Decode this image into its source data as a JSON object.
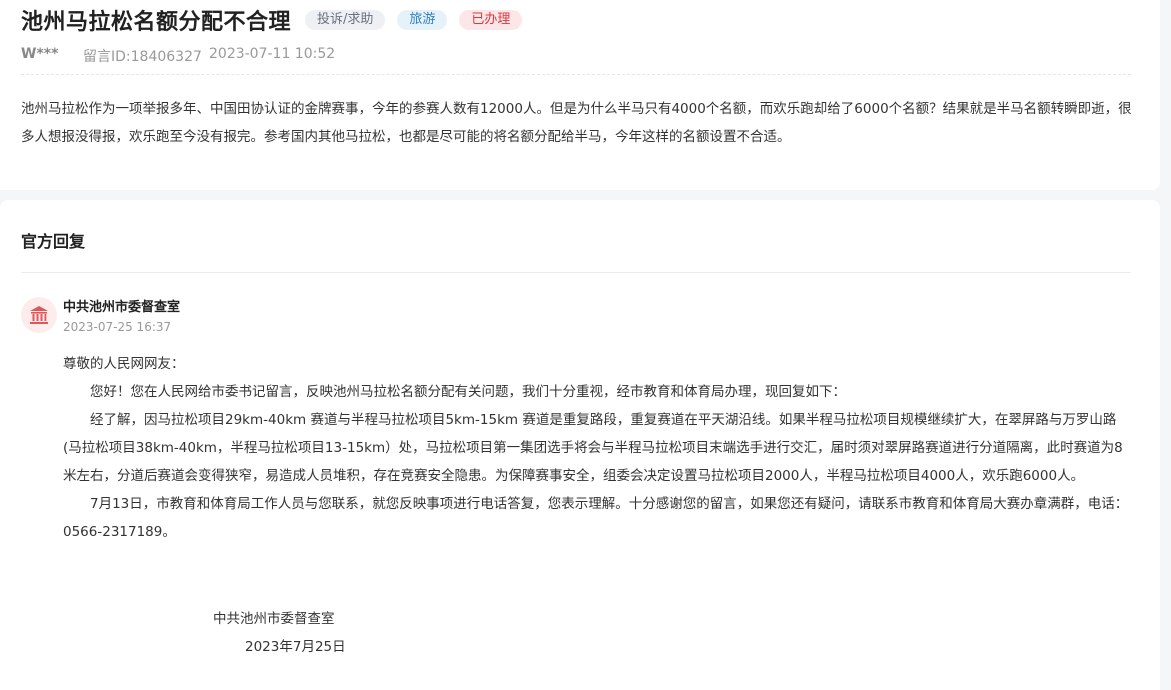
{
  "post": {
    "title": "池州马拉松名额分配不合理",
    "tags": [
      "投诉/求助",
      "旅游",
      "已办理"
    ],
    "author": "W***",
    "message_id": "留言ID:18406327",
    "datetime": "2023-07-11 10:52",
    "content": "池州马拉松作为一项举报多年、中国田协认证的金牌赛事，今年的参赛人数有12000人。但是为什么半马只有4000个名额，而欢乐跑却给了6000个名额？结果就是半马名额转瞬即逝，很多人想报没得报，欢乐跑至今没有报完。参考国内其他马拉松，也都是尽可能的将名额分配给半马，今年这样的名额设置不合适。"
  },
  "reply": {
    "heading": "官方回复",
    "org_name": "中共池州市委督查室",
    "date": "2023-07-25 16:37",
    "greeting": "尊敬的人民网网友：",
    "paragraphs": [
      "您好！您在人民网给市委书记留言，反映池州马拉松名额分配有关问题，我们十分重视，经市教育和体育局办理，现回复如下：",
      "经了解，因马拉松项目29km-40km 赛道与半程马拉松项目5km-15km 赛道是重复路段，重复赛道在平天湖沿线。如果半程马拉松项目规模继续扩大，在翠屏路与万罗山路(马拉松项目38km-40km，半程马拉松项目13-15km）处，马拉松项目第一集团选手将会与半程马拉松项目末端选手进行交汇，届时须对翠屏路赛道进行分道隔离，此时赛道为8米左右，分道后赛道会变得狭窄，易造成人员堆积，存在竞赛安全隐患。为保障赛事安全，组委会决定设置马拉松项目2000人，半程马拉松项目4000人，欢乐跑6000人。",
      "7月13日，市教育和体育局工作人员与您联系，就您反映事项进行电话答复，您表示理解。十分感谢您的留言，如果您还有疑问，请联系市教育和体育局大赛办章满群，电话：0566-2317189。"
    ],
    "signature": "中共池州市委督查室",
    "signature_date": "2023年7月25日"
  },
  "icons": {
    "avatar": "government-building-icon"
  },
  "colors": {
    "tag_complaint": "#6b7180",
    "tag_travel": "#2f7fbf",
    "tag_done": "#d8383f",
    "avatar_accent": "#e0575b"
  }
}
